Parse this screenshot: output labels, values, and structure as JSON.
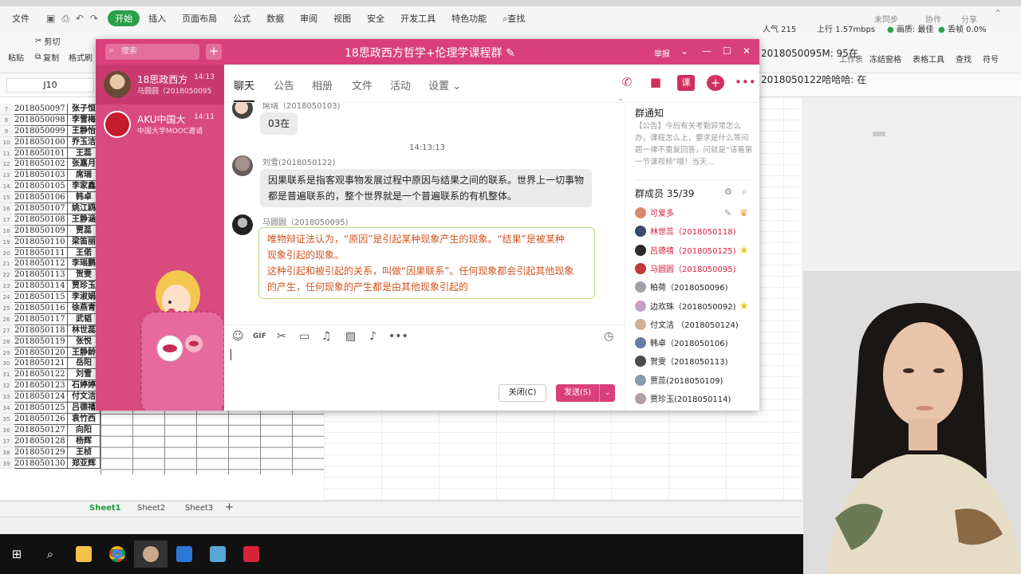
{
  "wps": {
    "tabs": [
      "文件",
      "开始",
      "插入",
      "页面布局",
      "公式",
      "数据",
      "审阅",
      "视图",
      "安全",
      "开发工具",
      "特色功能"
    ],
    "active_tab": "开始",
    "find": "查找",
    "ribbon": {
      "paste": "粘贴",
      "cut": "剪切",
      "copy": "复制",
      "format_painter": "格式刷"
    },
    "ribbon_right": [
      "冻结窗格",
      "表格工具",
      "查找",
      "符号"
    ],
    "ribbon_right_partial": "工作表",
    "stream": {
      "popularity": "人气 215",
      "upload": "上行 1.57mbps",
      "quality": "画质: 最佳",
      "packet_loss": "丢帧 0.0%"
    },
    "top_right": {
      "sync": "未同步",
      "collab": "协作",
      "share": "分享"
    },
    "cell_ref": "J10",
    "chat_overlay": [
      "2018050095M: 95在",
      "2018050122哈哈哈: 在"
    ],
    "row_numbers": [
      "7",
      "8",
      "9",
      "10",
      "11",
      "12",
      "13",
      "14",
      "15",
      "16",
      "17",
      "18",
      "19",
      "20",
      "21",
      "22",
      "23",
      "24",
      "25",
      "26",
      "27",
      "28",
      "29",
      "30",
      "31",
      "32",
      "33",
      "34",
      "35",
      "36",
      "37",
      "38",
      "39"
    ],
    "ids": [
      "2018050097",
      "2018050098",
      "2018050099",
      "2018050100",
      "2018050101",
      "2018050102",
      "2018050103",
      "2018050105",
      "2018050106",
      "2018050107",
      "2018050108",
      "2018050109",
      "2018050110",
      "2018050111",
      "2018050112",
      "2018050113",
      "2018050114",
      "2018050115",
      "2018050116",
      "2018050117",
      "2018050118",
      "2018050119",
      "2018050120",
      "2018050121",
      "2018050122",
      "2018050123",
      "2018050124",
      "2018050125",
      "2018050126",
      "2018050127",
      "2018050128",
      "2018050129",
      "2018050130"
    ],
    "names": [
      "张子恒",
      "李雪梅",
      "王静怡",
      "乔玉洁",
      "王蕊",
      "张嘉月",
      "席瑞",
      "李家鑫",
      "韩卓",
      "姚江鸥",
      "王静涵",
      "贾蕊",
      "梁笛丽",
      "王偌",
      "李瑶鹏",
      "贺雯",
      "贾珍玉",
      "李淑娟",
      "徐燕青",
      "武韬",
      "林世蕊",
      "张悦",
      "王静龄",
      "岳阳",
      "刘雪",
      "石婷婷",
      "付文洁",
      "吕德禧",
      "袁竹西",
      "向阳",
      "杨辉",
      "王桢",
      "郑亚辉"
    ],
    "sheets": [
      "Sheet1",
      "Sheet2",
      "Sheet3"
    ],
    "active_sheet": "Sheet1"
  },
  "qq": {
    "search_placeholder": "搜索",
    "title": "18思政西方哲学+伦理学课程群",
    "report": "举报",
    "conversations": [
      {
        "name": "18思政西方",
        "time": "14:13",
        "preview": "马圆圆（2018050095"
      },
      {
        "name": "AKU中国大",
        "time": "14:11",
        "preview": "中国大学MOOC邀请"
      }
    ],
    "tabs": [
      "聊天",
      "公告",
      "相册",
      "文件",
      "活动",
      "设置"
    ],
    "active_tab": "聊天",
    "messages": [
      {
        "sender": "席瑞（2018050103)",
        "text": "03在"
      },
      {
        "sender": "刘雪(2018050122)",
        "text": "因果联系是指客观事物发展过程中原因与结果之间的联系。世界上一切事物都是普遍联系的，整个世界就是一个普遍联系的有机整体。"
      },
      {
        "sender": "马圆圆（2018050095)",
        "text_lines": [
          "唯物辩证法认为，“原因”是引起某种现象产生的现象。“结果”是被某种",
          "现象引起的现象。",
          "这种引起和被引起的关系，叫做“因果联系”。任何现象都会引起其他现象",
          "的产生，任何现象的产生都是由其他现象引起的"
        ]
      }
    ],
    "timestamp": "14:13:13",
    "close_button": "关闭(C)",
    "send_button": "发送(S)",
    "notice": {
      "title": "群通知",
      "body": "【公告】今后有关考勤异常怎么办，课程怎么上，要求是什么等问题一律不重复回答，问就是“请看第一节课视频”哦！当天..."
    },
    "members_title": "群成员 35/39",
    "members": [
      {
        "name": "可爱多",
        "highlight": true
      },
      {
        "name": "林世蕊（2018050118)",
        "highlight": true
      },
      {
        "name": "吕德禧（2018050125)",
        "highlight": true
      },
      {
        "name": "马圆圆（2018050095)",
        "highlight": true
      },
      {
        "name": "柏荷（2018050096)",
        "highlight": false
      },
      {
        "name": "边欢珠（2018050092)",
        "highlight": false
      },
      {
        "name": "付文洁 （2018050124)",
        "highlight": false
      },
      {
        "name": "韩卓（2018050106)",
        "highlight": false
      },
      {
        "name": "贺雯（2018050113)",
        "highlight": false
      },
      {
        "name": "贾蕊(2018050109)",
        "highlight": false
      },
      {
        "name": "贾珍玉(2018050114)",
        "highlight": false
      }
    ]
  }
}
